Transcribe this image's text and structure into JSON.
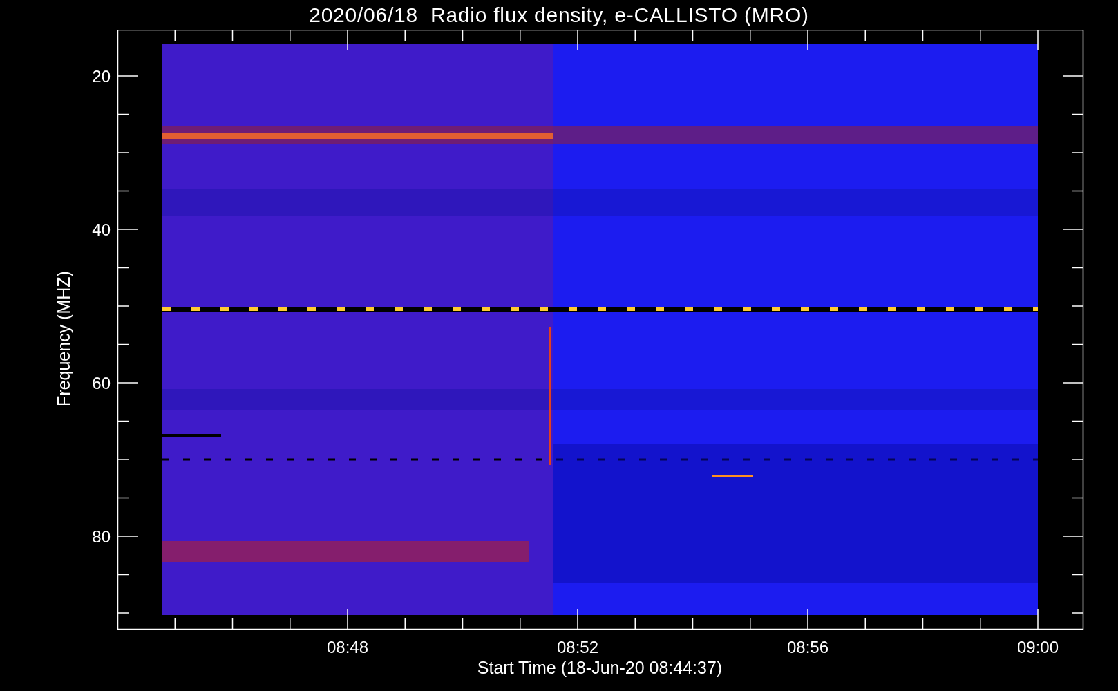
{
  "title": "2020/06/18  Radio flux density, e-CALLISTO (MRO)",
  "y_axis": {
    "label": "Frequency (MHZ)",
    "ticks": [
      "20",
      "40",
      "60",
      "80"
    ]
  },
  "x_axis": {
    "label": "Start Time (18-Jun-20 08:44:37)",
    "ticks": [
      "08:48",
      "08:52",
      "08:56",
      "09:00"
    ]
  }
}
